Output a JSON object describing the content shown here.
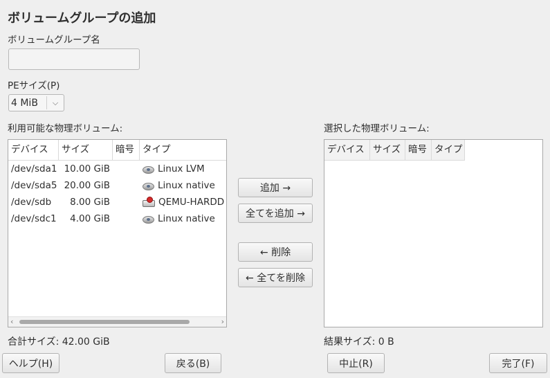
{
  "dialog": {
    "title": "ボリュームグループの追加",
    "vg_name_label": "ボリュームグループ名",
    "vg_name_value": "",
    "pe_size_label": "PEサイズ(P)",
    "pe_size_value": "4 MiB"
  },
  "available": {
    "label": "利用可能な物理ボリューム:",
    "columns": [
      "デバイス",
      "サイズ",
      "暗号",
      "タイプ"
    ],
    "rows": [
      {
        "device": "/dev/sda1",
        "size": "10.00 GiB",
        "icon": "disk-icon",
        "type": "Linux LVM"
      },
      {
        "device": "/dev/sda5",
        "size": "20.00 GiB",
        "icon": "disk-icon",
        "type": "Linux native"
      },
      {
        "device": "/dev/sdb",
        "size": "8.00 GiB",
        "icon": "hard-drive-icon",
        "type": "QEMU-HARDD"
      },
      {
        "device": "/dev/sdc1",
        "size": "4.00 GiB",
        "icon": "disk-icon",
        "type": "Linux native"
      }
    ],
    "total": "合計サイズ: 42.00 GiB"
  },
  "selected": {
    "label": "選択した物理ボリューム:",
    "columns": [
      "デバイス",
      "サイズ",
      "暗号",
      "タイプ"
    ],
    "total": "結果サイズ: 0 B"
  },
  "transfer": {
    "add": "追加 →",
    "add_all": "全てを追加 →",
    "remove": "← 削除",
    "remove_all": "← 全てを削除"
  },
  "footer": {
    "help": "ヘルプ(H)",
    "back": "戻る(B)",
    "abort": "中止(R)",
    "finish": "完了(F)"
  }
}
